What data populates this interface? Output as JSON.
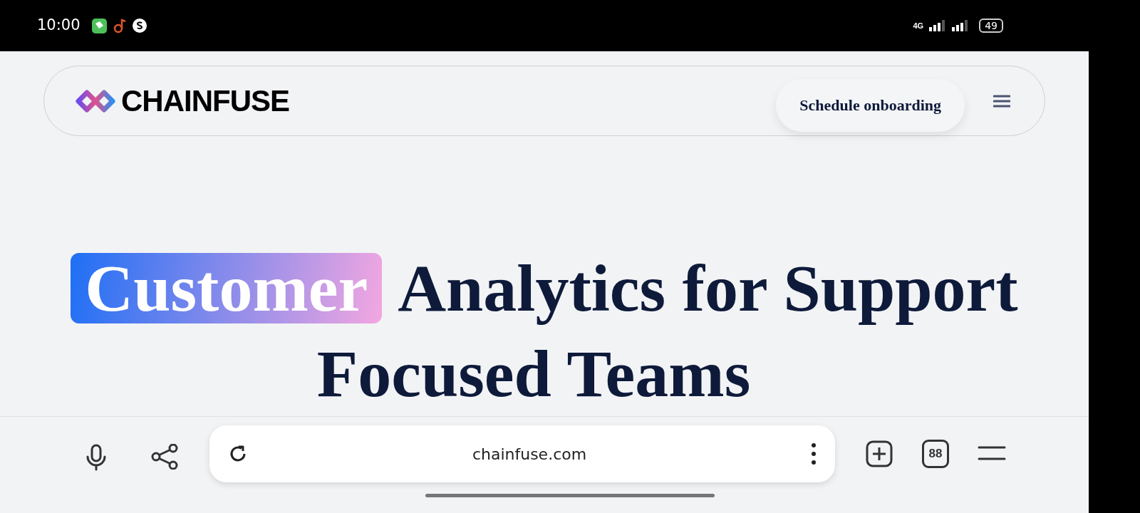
{
  "status_bar": {
    "time": "10:00",
    "network": "4G",
    "battery": "49"
  },
  "nav": {
    "logo": "CHAINFUSE",
    "button": "Schedule onboarding"
  },
  "headline": {
    "highlight": "Customer",
    "line_1": "Analytics for Support",
    "line_2": "Focused Teams"
  },
  "browser_bar": {
    "url": "chainfuse.com",
    "tab_count": "88"
  }
}
